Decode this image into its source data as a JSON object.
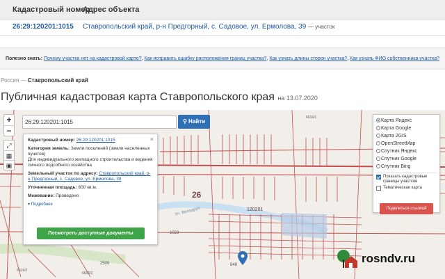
{
  "results_table": {
    "col_number": "Кадастровый номер",
    "col_address": "Адрес объекта",
    "row": {
      "number": "26:29:120201:1015",
      "address": "Ставропольский край, р-н Предгорный, с. Садовое, ул. Ермолова, 39",
      "type": "— участок"
    }
  },
  "useful": {
    "label": "Полезно знать:",
    "links": [
      "Почему участка нет на кадастровой карте?",
      "Как исправить ошибку расположения границ участка?",
      "Как узнать длины сторон участка?",
      "Как узнать ФИО собственника участка?"
    ]
  },
  "breadcrumb": {
    "root": "Россия",
    "sep": "—",
    "current": "Ставропольский край"
  },
  "page": {
    "title": "Публичная кадастровая карта Ставропольского края",
    "date": "на 13.07.2020"
  },
  "map": {
    "zoom_in": "+",
    "zoom_out": "−",
    "search_value": "26:29:120201:1015",
    "search_button": "Найти",
    "labels": {
      "block": "26",
      "quarter": "120201",
      "street": "Ул. Велодруп",
      "n1": "1023",
      "n2": "2506",
      "n3": "648",
      "n4": "6616/2",
      "n5": "6616/2",
      "n6": "6616/1"
    }
  },
  "info_popup": {
    "close": "×",
    "cad_label": "Кадастровый номер:",
    "cad_value": "26:29:120201:1015",
    "category_label": "Категория земель:",
    "category_value": "Земли поселений (земли населенных пунктов)",
    "use_value": "Для индивидуального жилищного строительства и ведения личного подсобного хозяйства",
    "address_label": "Земельный участок по адресу:",
    "address_value": "Ставропольский край, р-н Предгорный, с. Садовое, ул. Ермолова, 39",
    "area_label": "Уточненная площадь:",
    "area_value": "600 кв.м.",
    "survey_label": "Межевание:",
    "survey_value": "Проведено",
    "more": "Подробнее",
    "docs_button": "Посмотреть доступные документы"
  },
  "layers": {
    "options": [
      "Карта Яндекс",
      "Карта Google",
      "Карта 2GIS",
      "OpenStreetMap",
      "Спутник Яндекс",
      "Спутник Google",
      "Спутник Bing"
    ],
    "selected": 0,
    "show_borders": "Показать кадастровые границы участков",
    "thematic": "Тематическая карта",
    "share_button": "Поделиться ссылкой"
  },
  "watermark": {
    "text": "rosndv.ru"
  },
  "colors": {
    "accent": "#2f6fb5",
    "primary_action": "#3fa347",
    "share": "#d9534f",
    "link": "#1f5aa6",
    "parcel_lines": "#c0504d"
  }
}
